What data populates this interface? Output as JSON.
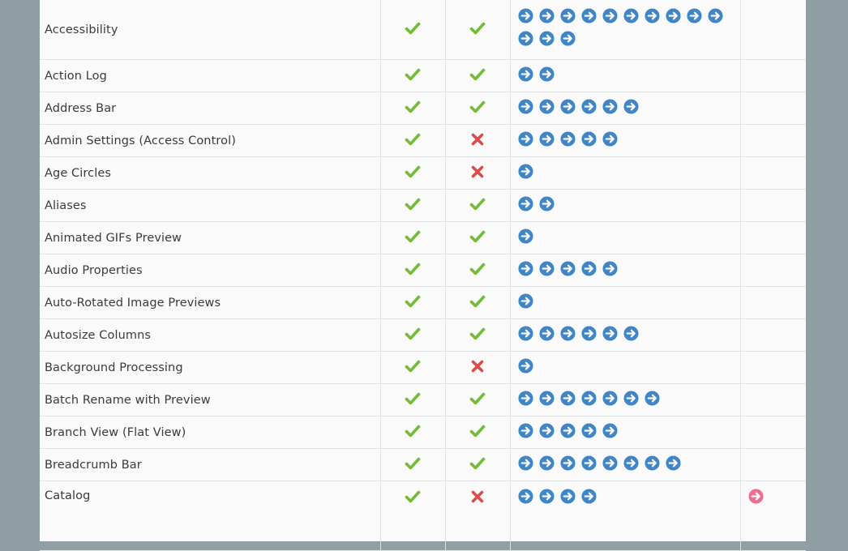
{
  "colors": {
    "check": "#72bd34",
    "cross": "#df4a4a",
    "arrow": "#3f86c8",
    "arrow_alt": "#ec6f90"
  },
  "rows": [
    {
      "name": "Accessibility",
      "a": "check",
      "b": "check",
      "links": 13,
      "extra": false
    },
    {
      "name": "Action Log",
      "a": "check",
      "b": "check",
      "links": 2,
      "extra": false
    },
    {
      "name": "Address Bar",
      "a": "check",
      "b": "check",
      "links": 6,
      "extra": false
    },
    {
      "name": "Admin Settings (Access Control)",
      "a": "check",
      "b": "cross",
      "links": 5,
      "extra": false
    },
    {
      "name": "Age Circles",
      "a": "check",
      "b": "cross",
      "links": 1,
      "extra": false
    },
    {
      "name": "Aliases",
      "a": "check",
      "b": "check",
      "links": 2,
      "extra": false
    },
    {
      "name": "Animated GIFs Preview",
      "a": "check",
      "b": "check",
      "links": 1,
      "extra": false
    },
    {
      "name": "Audio Properties",
      "a": "check",
      "b": "check",
      "links": 5,
      "extra": false
    },
    {
      "name": "Auto-Rotated Image Previews",
      "a": "check",
      "b": "check",
      "links": 1,
      "extra": false
    },
    {
      "name": "Autosize Columns",
      "a": "check",
      "b": "check",
      "links": 6,
      "extra": false
    },
    {
      "name": "Background Processing",
      "a": "check",
      "b": "cross",
      "links": 1,
      "extra": false
    },
    {
      "name": "Batch Rename with Preview",
      "a": "check",
      "b": "check",
      "links": 7,
      "extra": false
    },
    {
      "name": "Branch View (Flat View)",
      "a": "check",
      "b": "check",
      "links": 5,
      "extra": false
    },
    {
      "name": "Breadcrumb Bar",
      "a": "check",
      "b": "check",
      "links": 8,
      "extra": false
    },
    {
      "name": "Catalog",
      "a": "check",
      "b": "cross",
      "links": 4,
      "extra": true
    }
  ]
}
